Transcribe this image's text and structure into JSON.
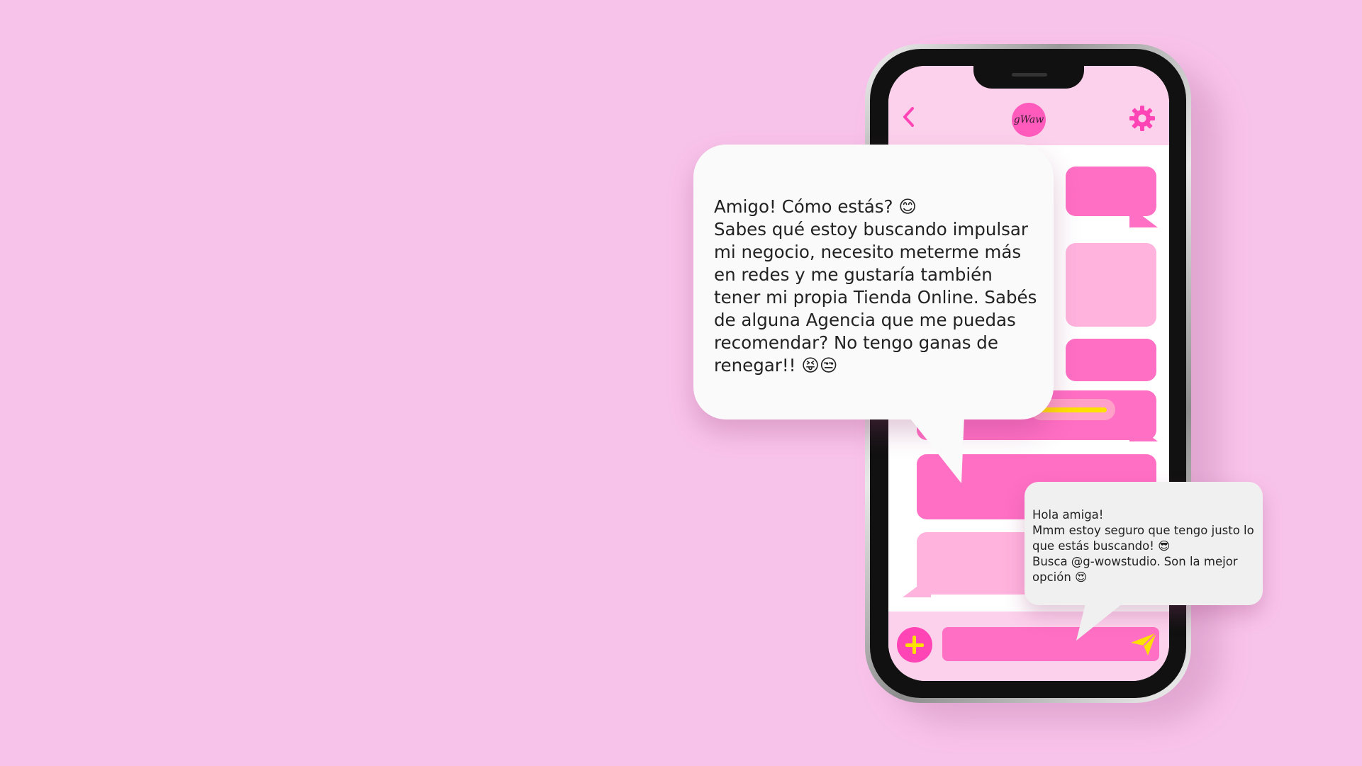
{
  "app": {
    "logo_text": "gWaw",
    "colors": {
      "background": "#f8c3ea",
      "accent_pink": "#ff45b6",
      "bubble_hot": "#ff6fc4",
      "bubble_soft": "#ffb3dd",
      "accent_yellow": "#ffe100"
    }
  },
  "header": {
    "back_icon": "chevron-left-icon",
    "settings_icon": "gear-icon"
  },
  "messages": {
    "incoming": "Amigo! Cómo estás? 😊\nSabes qué estoy buscando impulsar mi negocio, necesito meterme más en redes y me gustaría también tener mi propia Tienda Online. Sabés de alguna Agencia que me puedas recomendar? No tengo ganas de renegar!! 😝😒",
    "reply": "Hola amiga!\nMmm estoy seguro que tengo justo lo que estás buscando! 😎\nBusca @g-wowstudio. Son la mejor opción 😍"
  },
  "composer": {
    "add_icon": "plus-icon",
    "send_icon": "send-icon",
    "input_value": ""
  }
}
